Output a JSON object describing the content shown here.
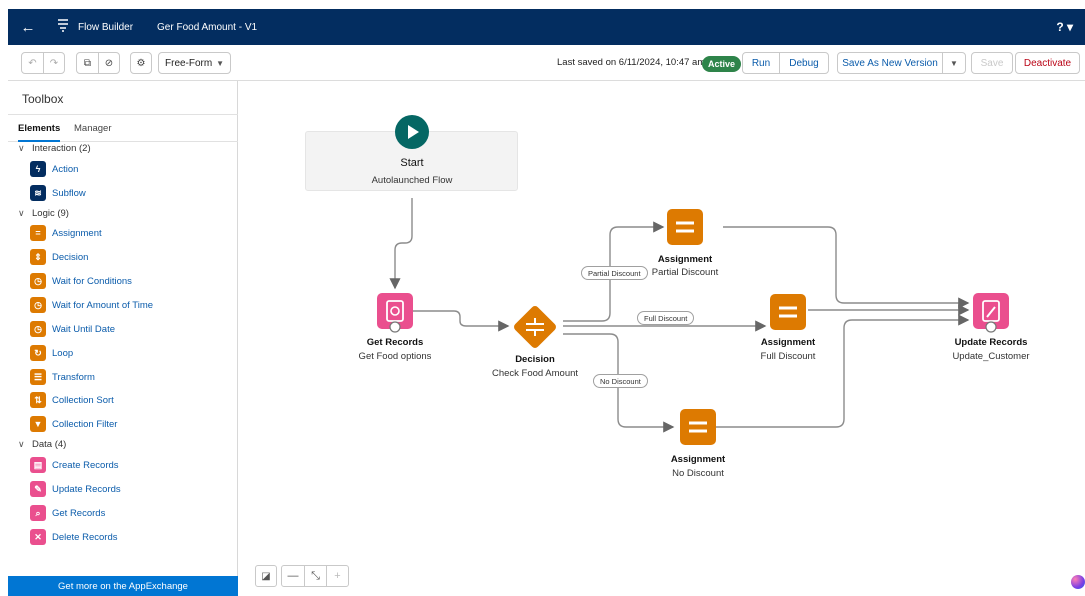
{
  "header": {
    "back_icon": "arrow-left-icon",
    "app_name": "Flow Builder",
    "flow_name": "Ger Food Amount - V1",
    "help_label": "? ▾"
  },
  "toolbar": {
    "layout_select": "Free-Form",
    "last_saved": "Last saved on 6/11/2024, 10:47 am",
    "status_badge": "Active",
    "run_label": "Run",
    "debug_label": "Debug",
    "save_new_version_label": "Save As New Version",
    "save_label": "Save",
    "deactivate_label": "Deactivate"
  },
  "sidebar": {
    "title": "Toolbox",
    "tabs": [
      "Elements",
      "Manager"
    ],
    "sections": [
      {
        "label": "Interaction (2)",
        "items": [
          "Action",
          "Subflow"
        ]
      },
      {
        "label": "Logic (9)",
        "items": [
          "Assignment",
          "Decision",
          "Wait for Conditions",
          "Wait for Amount of Time",
          "Wait Until Date",
          "Loop",
          "Transform",
          "Collection Sort",
          "Collection Filter"
        ]
      },
      {
        "label": "Data (4)",
        "items": [
          "Create Records",
          "Update Records",
          "Get Records",
          "Delete Records"
        ]
      }
    ],
    "appexchange_label": "Get more on the AppExchange"
  },
  "canvas": {
    "start": {
      "title": "Start",
      "subtitle": "Autolaunched Flow"
    },
    "get_records": {
      "title": "Get Records",
      "subtitle": "Get Food options"
    },
    "decision": {
      "title": "Decision",
      "subtitle": "Check Food Amount"
    },
    "assign_partial": {
      "title": "Assignment",
      "subtitle": "Partial Discount"
    },
    "assign_full": {
      "title": "Assignment",
      "subtitle": "Full Discount"
    },
    "assign_none": {
      "title": "Assignment",
      "subtitle": "No Discount"
    },
    "update_records": {
      "title": "Update Records",
      "subtitle": "Update_Customer"
    },
    "outcomes": [
      "Partial Discount",
      "Full Discount",
      "No Discount"
    ]
  },
  "colors": {
    "header_bg": "#032d60",
    "brand_blue": "#0176d3",
    "start_green": "#056764",
    "logic_orange": "#dd7a01",
    "data_pink": "#ea4f8e",
    "active_green": "#2e844a"
  }
}
